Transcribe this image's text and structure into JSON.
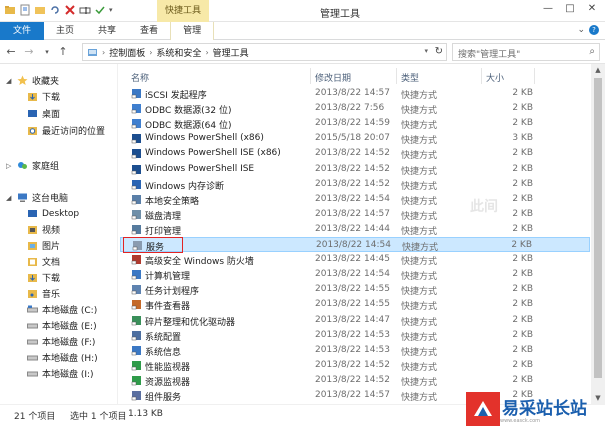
{
  "window": {
    "title": "管理工具",
    "context_tab": "快捷工具",
    "controls": [
      "—",
      "□",
      "✕"
    ]
  },
  "ribbon": {
    "tabs": [
      "文件",
      "主页",
      "共享",
      "查看",
      "管理"
    ],
    "right_icons": [
      "chevron-down-icon",
      "help-icon"
    ]
  },
  "address": {
    "path": [
      "控制面板",
      "系统和安全",
      "管理工具"
    ],
    "search_placeholder": "搜索\"管理工具\""
  },
  "nav": {
    "favorites": "收藏夹",
    "favorites_items": [
      "下载",
      "桌面",
      "最近访问的位置"
    ],
    "homegroup": "家庭组",
    "this_pc": "这台电脑",
    "pc_items": [
      "Desktop",
      "视频",
      "图片",
      "文档",
      "下载",
      "音乐",
      "本地磁盘 (C:)",
      "本地磁盘 (E:)",
      "本地磁盘 (F:)",
      "本地磁盘 (H:)",
      "本地磁盘 (I:)"
    ]
  },
  "columns": {
    "name": "名称",
    "date": "修改日期",
    "type": "类型",
    "size": "大小"
  },
  "files": [
    {
      "name": "iSCSI 发起程序",
      "date": "2013/8/22 14:57",
      "type": "快捷方式",
      "size": "2 KB"
    },
    {
      "name": "ODBC 数据源(32 位)",
      "date": "2013/8/22 7:56",
      "type": "快捷方式",
      "size": "2 KB"
    },
    {
      "name": "ODBC 数据源(64 位)",
      "date": "2013/8/22 14:59",
      "type": "快捷方式",
      "size": "2 KB"
    },
    {
      "name": "Windows PowerShell (x86)",
      "date": "2015/5/18 20:07",
      "type": "快捷方式",
      "size": "3 KB"
    },
    {
      "name": "Windows PowerShell ISE (x86)",
      "date": "2013/8/22 14:52",
      "type": "快捷方式",
      "size": "2 KB"
    },
    {
      "name": "Windows PowerShell ISE",
      "date": "2013/8/22 14:52",
      "type": "快捷方式",
      "size": "2 KB"
    },
    {
      "name": "Windows 内存诊断",
      "date": "2013/8/22 14:52",
      "type": "快捷方式",
      "size": "2 KB"
    },
    {
      "name": "本地安全策略",
      "date": "2013/8/22 14:54",
      "type": "快捷方式",
      "size": "2 KB"
    },
    {
      "name": "磁盘清理",
      "date": "2013/8/22 14:57",
      "type": "快捷方式",
      "size": "2 KB"
    },
    {
      "name": "打印管理",
      "date": "2013/8/22 14:44",
      "type": "快捷方式",
      "size": "2 KB"
    },
    {
      "name": "服务",
      "date": "2013/8/22 14:54",
      "type": "快捷方式",
      "size": "2 KB"
    },
    {
      "name": "高级安全 Windows 防火墙",
      "date": "2013/8/22 14:45",
      "type": "快捷方式",
      "size": "2 KB"
    },
    {
      "name": "计算机管理",
      "date": "2013/8/22 14:54",
      "type": "快捷方式",
      "size": "2 KB"
    },
    {
      "name": "任务计划程序",
      "date": "2013/8/22 14:55",
      "type": "快捷方式",
      "size": "2 KB"
    },
    {
      "name": "事件查看器",
      "date": "2013/8/22 14:55",
      "type": "快捷方式",
      "size": "2 KB"
    },
    {
      "name": "碎片整理和优化驱动器",
      "date": "2013/8/22 14:47",
      "type": "快捷方式",
      "size": "2 KB"
    },
    {
      "name": "系统配置",
      "date": "2013/8/22 14:53",
      "type": "快捷方式",
      "size": "2 KB"
    },
    {
      "name": "系统信息",
      "date": "2013/8/22 14:53",
      "type": "快捷方式",
      "size": "2 KB"
    },
    {
      "name": "性能监视器",
      "date": "2013/8/22 14:52",
      "type": "快捷方式",
      "size": "2 KB"
    },
    {
      "name": "资源监视器",
      "date": "2013/8/22 14:52",
      "type": "快捷方式",
      "size": "2 KB"
    },
    {
      "name": "组件服务",
      "date": "2013/8/22 14:57",
      "type": "快捷方式",
      "size": "2 KB"
    }
  ],
  "selected_index": 10,
  "status": {
    "count": "21 个项目",
    "selected": "选中 1 个项目",
    "size": "1.13 KB"
  },
  "watermark": {
    "text": "易采站长站",
    "url": "www.easck.com",
    "faint": "此间"
  },
  "colors": {
    "accent": "#1979ca",
    "selection": "#cce8ff",
    "context": "#f7e9a8",
    "highlight_box": "#e22424"
  }
}
